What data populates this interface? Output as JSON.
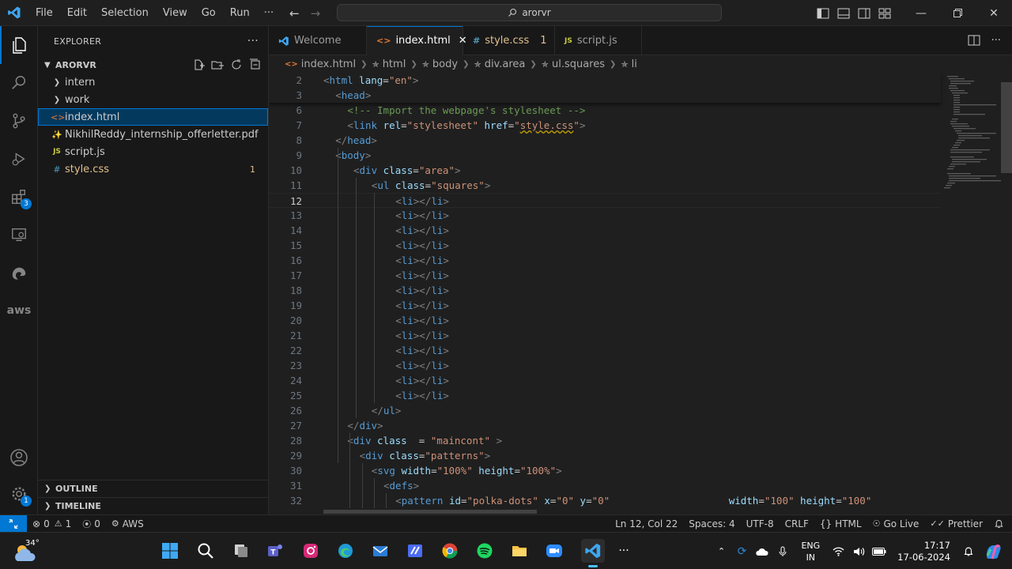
{
  "titlebar": {
    "menu": [
      "File",
      "Edit",
      "Selection",
      "View",
      "Go",
      "Run",
      "···"
    ],
    "search": "arorvr"
  },
  "sidebar": {
    "title": "EXPLORER",
    "root": "ARORVR",
    "items": [
      {
        "label": "intern",
        "kind": "folder"
      },
      {
        "label": "work",
        "kind": "folder"
      },
      {
        "label": "index.html",
        "kind": "html",
        "selected": true
      },
      {
        "label": "NikhilReddy_internship_offerletter.pdf",
        "kind": "pdf"
      },
      {
        "label": "script.js",
        "kind": "js"
      },
      {
        "label": "style.css",
        "kind": "css",
        "count": "1"
      }
    ],
    "outline": "OUTLINE",
    "timeline": "TIMELINE",
    "extensions_badge": "3",
    "settings_badge": "1"
  },
  "tabs": [
    {
      "label": "Welcome",
      "icon": "vscode"
    },
    {
      "label": "index.html",
      "icon": "html",
      "active": true
    },
    {
      "label": "style.css",
      "icon": "css",
      "count": "1"
    },
    {
      "label": "script.js",
      "icon": "js"
    }
  ],
  "breadcrumb": [
    "index.html",
    "html",
    "body",
    "div.area",
    "ul.squares",
    "li"
  ],
  "editor": {
    "lines": [
      {
        "n": "2",
        "indent": 0,
        "tokens": [
          [
            "br",
            "<"
          ],
          [
            "tag",
            "html"
          ],
          [
            "pl",
            " "
          ],
          [
            "at",
            "lang"
          ],
          [
            "pl",
            "="
          ],
          [
            "st",
            "\"en\""
          ],
          [
            "br",
            ">"
          ]
        ]
      },
      {
        "n": "3",
        "indent": 1,
        "tokens": [
          [
            "br",
            "<"
          ],
          [
            "tag",
            "head"
          ],
          [
            "br",
            ">"
          ]
        ]
      },
      {
        "n": "6",
        "indent": 2,
        "tokens": [
          [
            "cm",
            "<!-- Import the webpage's stylesheet -->"
          ]
        ]
      },
      {
        "n": "7",
        "indent": 2,
        "tokens": [
          [
            "br",
            "<"
          ],
          [
            "tag",
            "link"
          ],
          [
            "pl",
            " "
          ],
          [
            "at",
            "rel"
          ],
          [
            "pl",
            "="
          ],
          [
            "st",
            "\"stylesheet\""
          ],
          [
            "pl",
            " "
          ],
          [
            "at",
            "href"
          ],
          [
            "pl",
            "="
          ],
          [
            "st",
            "\""
          ],
          [
            "stu",
            "style.css"
          ],
          [
            "st",
            "\""
          ],
          [
            "br",
            ">"
          ]
        ]
      },
      {
        "n": "8",
        "indent": 1,
        "tokens": [
          [
            "br",
            "</"
          ],
          [
            "tag",
            "head"
          ],
          [
            "br",
            ">"
          ]
        ]
      },
      {
        "n": "9",
        "indent": 1,
        "tokens": [
          [
            "br",
            "<"
          ],
          [
            "tag",
            "body"
          ],
          [
            "br",
            ">"
          ]
        ]
      },
      {
        "n": "10",
        "indent": 2.5,
        "tokens": [
          [
            "br",
            "<"
          ],
          [
            "tag",
            "div"
          ],
          [
            "pl",
            " "
          ],
          [
            "at",
            "class"
          ],
          [
            "pl",
            "="
          ],
          [
            "st",
            "\"area\""
          ],
          [
            "br",
            ">"
          ]
        ]
      },
      {
        "n": "11",
        "indent": 4,
        "tokens": [
          [
            "br",
            "<"
          ],
          [
            "tag",
            "ul"
          ],
          [
            "pl",
            " "
          ],
          [
            "at",
            "class"
          ],
          [
            "pl",
            "="
          ],
          [
            "st",
            "\"squares\""
          ],
          [
            "br",
            ">"
          ]
        ]
      },
      {
        "n": "12",
        "indent": 6,
        "current": true,
        "tokens": [
          [
            "br",
            "<"
          ],
          [
            "tag",
            "li"
          ],
          [
            "br",
            "></"
          ],
          [
            "tag",
            "li"
          ],
          [
            "br",
            ">"
          ]
        ]
      },
      {
        "n": "13",
        "indent": 6,
        "tokens": [
          [
            "br",
            "<"
          ],
          [
            "tag",
            "li"
          ],
          [
            "br",
            "></"
          ],
          [
            "tag",
            "li"
          ],
          [
            "br",
            ">"
          ]
        ]
      },
      {
        "n": "14",
        "indent": 6,
        "tokens": [
          [
            "br",
            "<"
          ],
          [
            "tag",
            "li"
          ],
          [
            "br",
            "></"
          ],
          [
            "tag",
            "li"
          ],
          [
            "br",
            ">"
          ]
        ]
      },
      {
        "n": "15",
        "indent": 6,
        "tokens": [
          [
            "br",
            "<"
          ],
          [
            "tag",
            "li"
          ],
          [
            "br",
            "></"
          ],
          [
            "tag",
            "li"
          ],
          [
            "br",
            ">"
          ]
        ]
      },
      {
        "n": "16",
        "indent": 6,
        "tokens": [
          [
            "br",
            "<"
          ],
          [
            "tag",
            "li"
          ],
          [
            "br",
            "></"
          ],
          [
            "tag",
            "li"
          ],
          [
            "br",
            ">"
          ]
        ]
      },
      {
        "n": "17",
        "indent": 6,
        "tokens": [
          [
            "br",
            "<"
          ],
          [
            "tag",
            "li"
          ],
          [
            "br",
            "></"
          ],
          [
            "tag",
            "li"
          ],
          [
            "br",
            ">"
          ]
        ]
      },
      {
        "n": "18",
        "indent": 6,
        "tokens": [
          [
            "br",
            "<"
          ],
          [
            "tag",
            "li"
          ],
          [
            "br",
            "></"
          ],
          [
            "tag",
            "li"
          ],
          [
            "br",
            ">"
          ]
        ]
      },
      {
        "n": "19",
        "indent": 6,
        "tokens": [
          [
            "br",
            "<"
          ],
          [
            "tag",
            "li"
          ],
          [
            "br",
            "></"
          ],
          [
            "tag",
            "li"
          ],
          [
            "br",
            ">"
          ]
        ]
      },
      {
        "n": "20",
        "indent": 6,
        "tokens": [
          [
            "br",
            "<"
          ],
          [
            "tag",
            "li"
          ],
          [
            "br",
            "></"
          ],
          [
            "tag",
            "li"
          ],
          [
            "br",
            ">"
          ]
        ]
      },
      {
        "n": "21",
        "indent": 6,
        "tokens": [
          [
            "br",
            "<"
          ],
          [
            "tag",
            "li"
          ],
          [
            "br",
            "></"
          ],
          [
            "tag",
            "li"
          ],
          [
            "br",
            ">"
          ]
        ]
      },
      {
        "n": "22",
        "indent": 6,
        "tokens": [
          [
            "br",
            "<"
          ],
          [
            "tag",
            "li"
          ],
          [
            "br",
            "></"
          ],
          [
            "tag",
            "li"
          ],
          [
            "br",
            ">"
          ]
        ]
      },
      {
        "n": "23",
        "indent": 6,
        "tokens": [
          [
            "br",
            "<"
          ],
          [
            "tag",
            "li"
          ],
          [
            "br",
            "></"
          ],
          [
            "tag",
            "li"
          ],
          [
            "br",
            ">"
          ]
        ]
      },
      {
        "n": "24",
        "indent": 6,
        "tokens": [
          [
            "br",
            "<"
          ],
          [
            "tag",
            "li"
          ],
          [
            "br",
            "></"
          ],
          [
            "tag",
            "li"
          ],
          [
            "br",
            ">"
          ]
        ]
      },
      {
        "n": "25",
        "indent": 6,
        "tokens": [
          [
            "br",
            "<"
          ],
          [
            "tag",
            "li"
          ],
          [
            "br",
            "></"
          ],
          [
            "tag",
            "li"
          ],
          [
            "br",
            ">"
          ]
        ]
      },
      {
        "n": "26",
        "indent": 4,
        "tokens": [
          [
            "br",
            "</"
          ],
          [
            "tag",
            "ul"
          ],
          [
            "br",
            ">"
          ]
        ]
      },
      {
        "n": "27",
        "indent": 2,
        "tokens": [
          [
            "br",
            "</"
          ],
          [
            "tag",
            "div"
          ],
          [
            "br",
            ">"
          ]
        ]
      },
      {
        "n": "28",
        "indent": 2,
        "tokens": [
          [
            "br",
            "<"
          ],
          [
            "tag",
            "div"
          ],
          [
            "pl",
            " "
          ],
          [
            "at",
            "class"
          ],
          [
            "pl",
            "  = "
          ],
          [
            "st",
            "\"maincont\""
          ],
          [
            "pl",
            " "
          ],
          [
            "br",
            ">"
          ]
        ]
      },
      {
        "n": "29",
        "indent": 3,
        "tokens": [
          [
            "br",
            "<"
          ],
          [
            "tag",
            "div"
          ],
          [
            "pl",
            " "
          ],
          [
            "at",
            "class"
          ],
          [
            "pl",
            "="
          ],
          [
            "st",
            "\"patterns\""
          ],
          [
            "br",
            ">"
          ]
        ]
      },
      {
        "n": "30",
        "indent": 4,
        "tokens": [
          [
            "br",
            "<"
          ],
          [
            "tag",
            "svg"
          ],
          [
            "pl",
            " "
          ],
          [
            "at",
            "width"
          ],
          [
            "pl",
            "="
          ],
          [
            "st",
            "\"100%\""
          ],
          [
            "pl",
            " "
          ],
          [
            "at",
            "height"
          ],
          [
            "pl",
            "="
          ],
          [
            "st",
            "\"100%\""
          ],
          [
            "br",
            ">"
          ]
        ]
      },
      {
        "n": "31",
        "indent": 5,
        "tokens": [
          [
            "br",
            "<"
          ],
          [
            "tag",
            "defs"
          ],
          [
            "br",
            ">"
          ]
        ]
      },
      {
        "n": "32",
        "indent": 6,
        "tokens": [
          [
            "br",
            "<"
          ],
          [
            "tag",
            "pattern"
          ],
          [
            "pl",
            " "
          ],
          [
            "at",
            "id"
          ],
          [
            "pl",
            "="
          ],
          [
            "st",
            "\"polka-dots\""
          ],
          [
            "pl",
            " "
          ],
          [
            "at",
            "x"
          ],
          [
            "pl",
            "="
          ],
          [
            "st",
            "\"0\""
          ],
          [
            "pl",
            " "
          ],
          [
            "at",
            "y"
          ],
          [
            "pl",
            "="
          ],
          [
            "st",
            "\"0\""
          ],
          [
            "pl",
            "                    "
          ],
          [
            "at",
            "width"
          ],
          [
            "pl",
            "="
          ],
          [
            "st",
            "\"100\""
          ],
          [
            "pl",
            " "
          ],
          [
            "at",
            "height"
          ],
          [
            "pl",
            "="
          ],
          [
            "st",
            "\"100\""
          ]
        ]
      }
    ]
  },
  "statusbar": {
    "errors": "0",
    "warnings": "1",
    "ports": "0",
    "aws": "AWS",
    "position": "Ln 12, Col 22",
    "spaces": "Spaces: 4",
    "encoding": "UTF-8",
    "eol": "CRLF",
    "language": "HTML",
    "golive": "Go Live",
    "prettier": "Prettier"
  },
  "taskbar": {
    "temperature": "34°",
    "lang1": "ENG",
    "lang2": "IN",
    "time": "17:17",
    "date": "17-06-2024"
  }
}
